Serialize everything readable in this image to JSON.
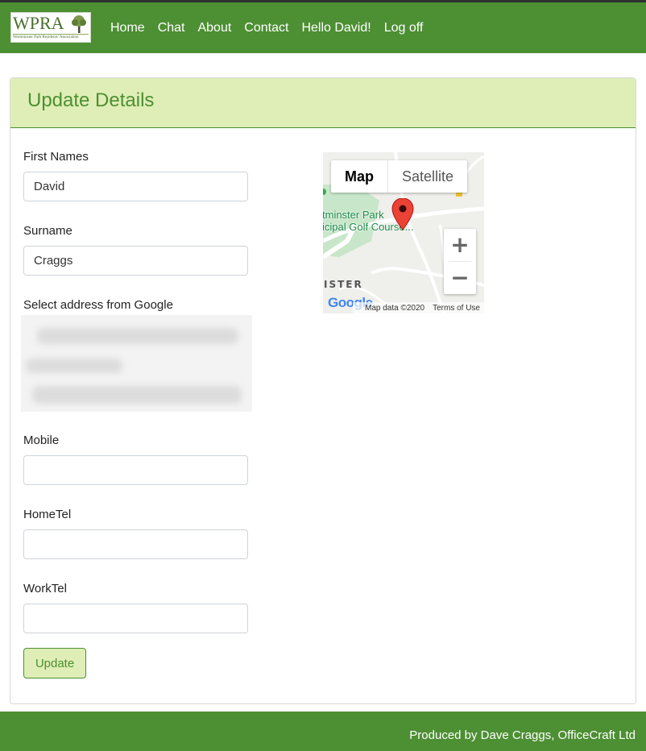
{
  "nav": {
    "logo": {
      "title": "WPRA",
      "subtitle": "Westminster Park Residents' Association"
    },
    "links": [
      "Home",
      "Chat",
      "About",
      "Contact",
      "Hello David!",
      "Log off"
    ]
  },
  "form": {
    "title": "Update Details",
    "fields": {
      "first_names": {
        "label": "First Names",
        "value": "David"
      },
      "surname": {
        "label": "Surname",
        "value": "Craggs"
      },
      "address": {
        "label": "Select address from Google"
      },
      "mobile": {
        "label": "Mobile",
        "value": ""
      },
      "home_tel": {
        "label": "HomeTel",
        "value": ""
      },
      "work_tel": {
        "label": "WorkTel",
        "value": ""
      }
    },
    "submit_label": "Update"
  },
  "map": {
    "tabs": {
      "map": "Map",
      "satellite": "Satellite"
    },
    "zoom_in": "+",
    "zoom_out": "−",
    "place_label_1": "tminster Park",
    "place_label_2": "icipal Golf Course...",
    "area_label": "ISTER",
    "logo": "Google",
    "attribution": "Map data ©2020",
    "terms": "Terms of Use"
  },
  "footer": {
    "text": "Produced by Dave Craggs, OfficeCraft Ltd"
  },
  "colors": {
    "brand_green": "#4d8f33",
    "header_light_green": "#dfeeb6"
  }
}
